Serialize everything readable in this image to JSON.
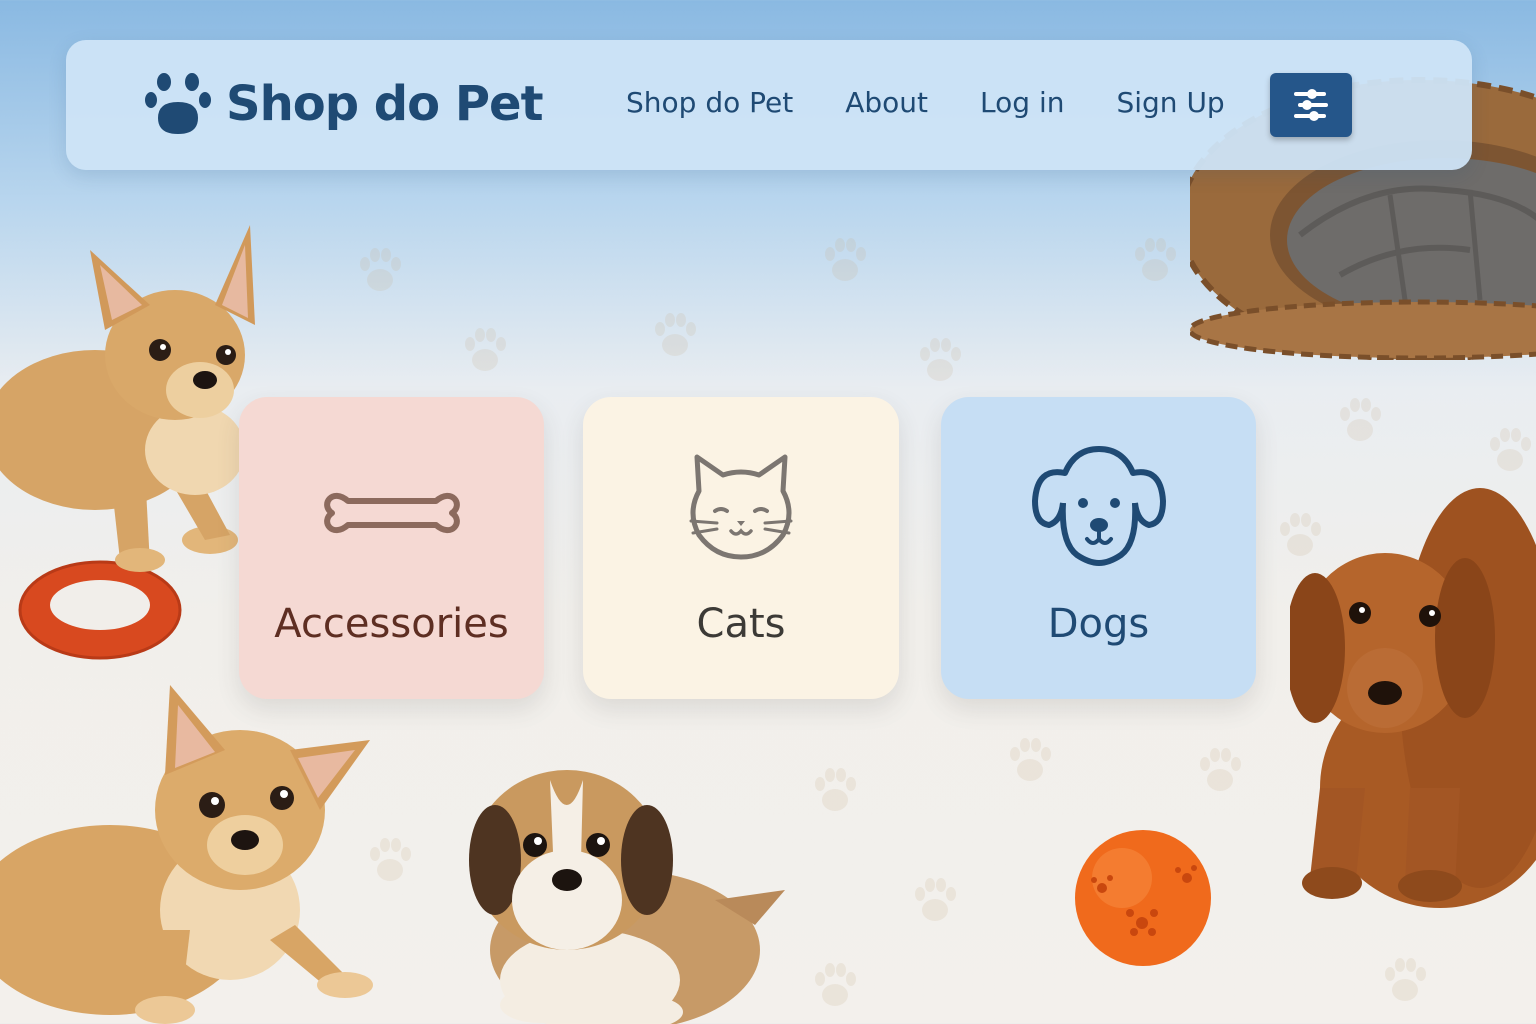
{
  "brand": {
    "name": "Shop do Pet",
    "logo_icon": "paw-icon"
  },
  "nav": {
    "links": [
      {
        "label": "Shop do Pet"
      },
      {
        "label": "About"
      },
      {
        "label": "Log in"
      },
      {
        "label": "Sign Up"
      }
    ],
    "menu_icon": "menu-icon"
  },
  "categories": [
    {
      "label": "Accessories",
      "icon": "bone-icon",
      "color": "#f5d9d3"
    },
    {
      "label": "Cats",
      "icon": "cat-icon",
      "color": "#fbf3e4"
    },
    {
      "label": "Dogs",
      "icon": "dog-icon",
      "color": "#c6def4"
    }
  ],
  "colors": {
    "primary": "#1f4a74",
    "menu_button": "#25568a",
    "accent_orange": "#e86a2b"
  }
}
